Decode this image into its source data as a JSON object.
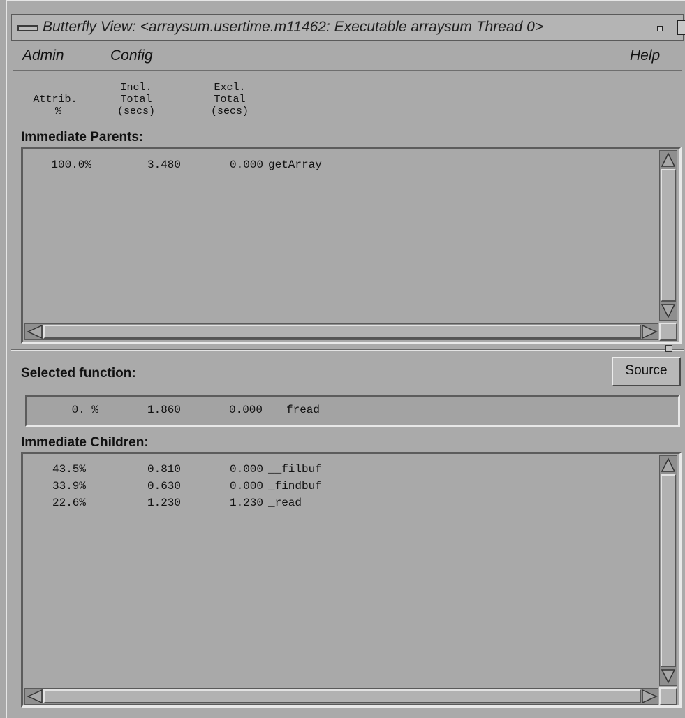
{
  "window": {
    "title": "Butterfly View: <arraysum.usertime.m11462: Executable arraysum Thread 0>"
  },
  "menu": {
    "admin": "Admin",
    "config": "Config",
    "help": "Help"
  },
  "columns": {
    "attrib": "Attrib.\n %",
    "incl": "Incl.\nTotal\n(secs)",
    "excl": "Excl.\nTotal\n(secs)"
  },
  "sections": {
    "parents": "Immediate Parents:",
    "selected": "Selected function:",
    "children": "Immediate Children:"
  },
  "source_button": "Source",
  "parents": [
    {
      "attrib": "100.0%",
      "incl": "3.480",
      "excl": "0.000",
      "name": "getArray"
    }
  ],
  "selected_function": {
    "attrib": "0. %",
    "incl": "1.860",
    "excl": "0.000",
    "name": "fread"
  },
  "children": [
    {
      "attrib": "43.5%",
      "incl": "0.810",
      "excl": "0.000",
      "name": "__filbuf"
    },
    {
      "attrib": "33.9%",
      "incl": "0.630",
      "excl": "0.000",
      "name": "_findbuf"
    },
    {
      "attrib": "22.6%",
      "incl": "1.230",
      "excl": "1.230",
      "name": "_read"
    }
  ]
}
